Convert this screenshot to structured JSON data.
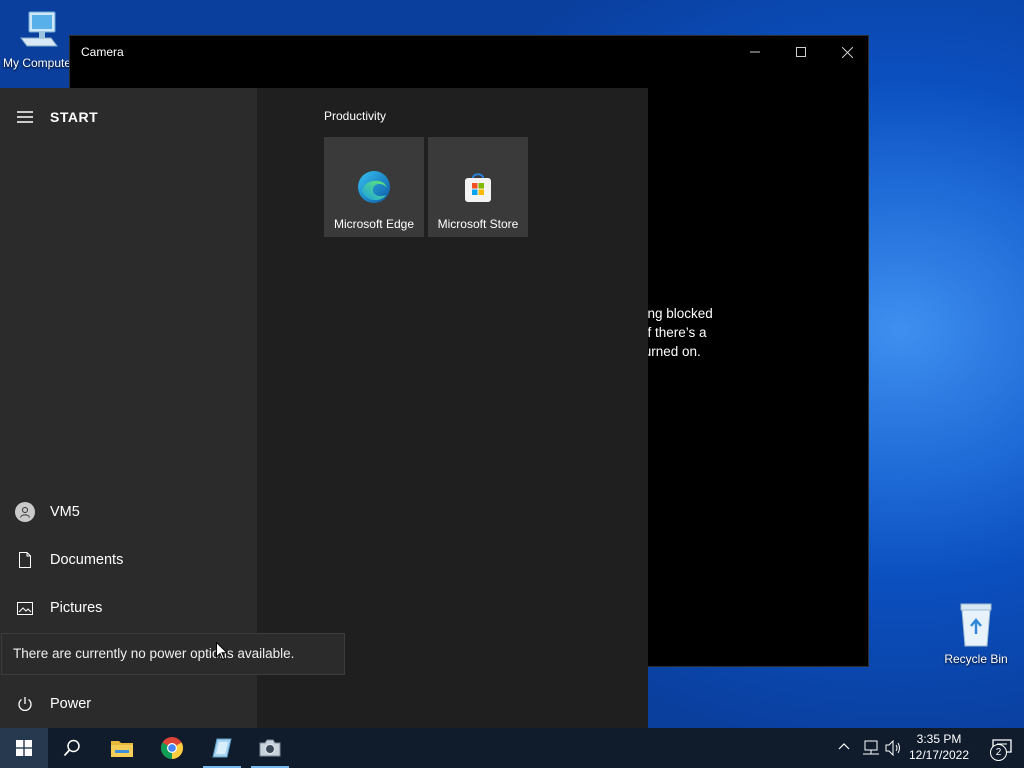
{
  "desktop": {
    "my_computer_label": "My Computer",
    "recycle_bin_label": "Recycle Bin"
  },
  "camera_window": {
    "title": "Camera",
    "message_fragments": [
      ": being blocked",
      "te. If there’s a",
      "it’s turned on."
    ],
    "controls": [
      "minimize-icon",
      "maximize-icon",
      "close-icon"
    ]
  },
  "start_menu": {
    "header_label": "START",
    "left_items": {
      "user": "VM5",
      "documents": "Documents",
      "pictures": "Pictures",
      "power": "Power"
    },
    "group_label": "Productivity",
    "tiles": [
      {
        "label": "Microsoft Edge",
        "icon": "edge-icon"
      },
      {
        "label": "Microsoft Store",
        "icon": "store-icon"
      }
    ],
    "power_tooltip": "There are currently no power options available."
  },
  "taskbar": {
    "apps": [
      "windows-start-icon",
      "search-icon",
      "file-explorer-icon",
      "chrome-icon",
      "app-icon",
      "camera-icon"
    ],
    "time": "3:35 PM",
    "date": "12/17/2022",
    "notification_count": "2",
    "colors": {
      "taskbar": "#101c2b",
      "running_indicator": "#76b9ed"
    }
  }
}
